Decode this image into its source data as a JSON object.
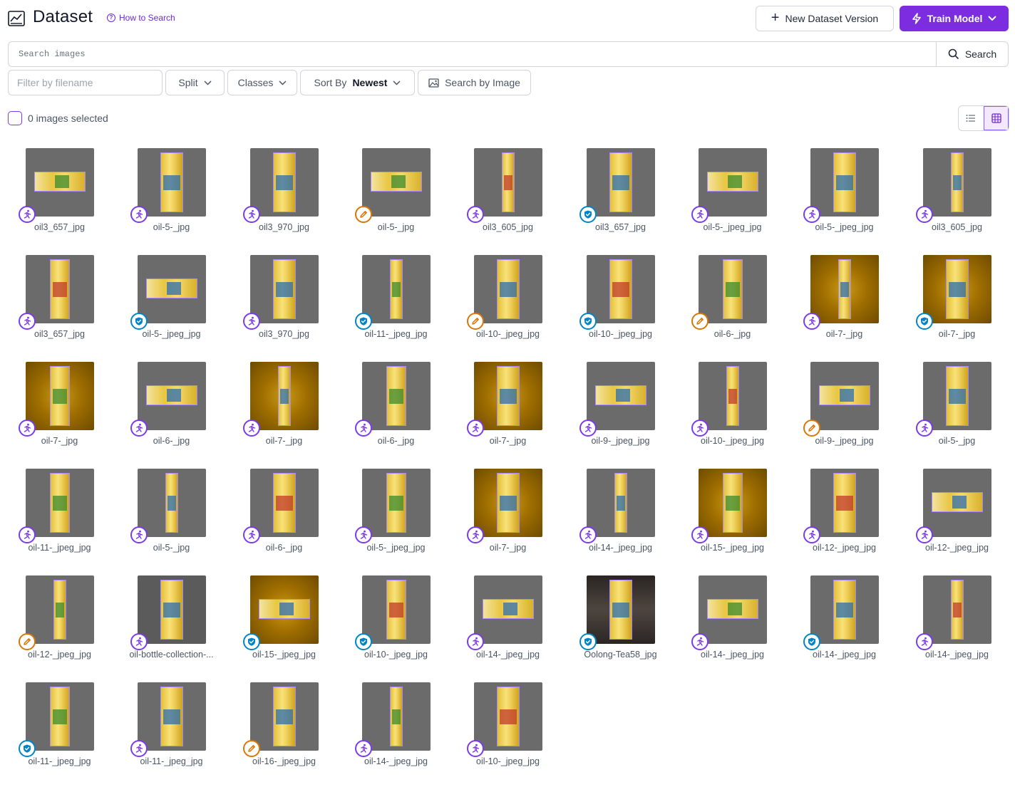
{
  "header": {
    "title": "Dataset",
    "how_to_search": "How to Search",
    "new_version_label": "New Dataset Version",
    "train_label": "Train Model"
  },
  "search": {
    "placeholder": "Search images",
    "button_label": "Search"
  },
  "filters": {
    "filename_placeholder": "Filter by filename",
    "split_label": "Split",
    "classes_label": "Classes",
    "sort_prefix": "Sort By",
    "sort_value": "Newest",
    "search_by_image_label": "Search by Image"
  },
  "selection": {
    "label": "0 images selected"
  },
  "colors": {
    "accent": "#7c2ddf",
    "badge_annotate": "#7c3aed",
    "badge_edit": "#d97706",
    "badge_approved": "#0284c7"
  },
  "images": [
    {
      "name": "oil3_657_jpg",
      "badge": "run",
      "bg": "gray",
      "orient": "h"
    },
    {
      "name": "oil-5-_jpg",
      "badge": "run",
      "bg": "gray",
      "orient": "v"
    },
    {
      "name": "oil3_970_jpg",
      "badge": "run",
      "bg": "gray",
      "orient": "v"
    },
    {
      "name": "oil-5-_jpg",
      "badge": "edit",
      "bg": "gray",
      "orient": "h"
    },
    {
      "name": "oil3_605_jpg",
      "badge": "run",
      "bg": "gray",
      "orient": "v"
    },
    {
      "name": "oil3_657_jpg",
      "badge": "shield",
      "bg": "gray",
      "orient": "v"
    },
    {
      "name": "oil-5-_jpeg_jpg",
      "badge": "run",
      "bg": "gray",
      "orient": "h"
    },
    {
      "name": "oil-5-_jpeg_jpg",
      "badge": "run",
      "bg": "gray",
      "orient": "v"
    },
    {
      "name": "oil3_605_jpg",
      "badge": "run",
      "bg": "gray",
      "orient": "v"
    },
    {
      "name": "oil3_657_jpg",
      "badge": "run",
      "bg": "gray",
      "orient": "v"
    },
    {
      "name": "oil-5-_jpeg_jpg",
      "badge": "shield",
      "bg": "gray",
      "orient": "h"
    },
    {
      "name": "oil3_970_jpg",
      "badge": "run",
      "bg": "gray",
      "orient": "v"
    },
    {
      "name": "oil-11-_jpeg_jpg",
      "badge": "shield",
      "bg": "gray",
      "orient": "v"
    },
    {
      "name": "oil-10-_jpeg_jpg",
      "badge": "edit",
      "bg": "gray",
      "orient": "v"
    },
    {
      "name": "oil-10-_jpeg_jpg",
      "badge": "shield",
      "bg": "gray",
      "orient": "v"
    },
    {
      "name": "oil-6-_jpg",
      "badge": "edit",
      "bg": "gray",
      "orient": "v"
    },
    {
      "name": "oil-7-_jpg",
      "badge": "run",
      "bg": "amber",
      "orient": "v"
    },
    {
      "name": "oil-7-_jpg",
      "badge": "shield",
      "bg": "amber",
      "orient": "v"
    },
    {
      "name": "oil-7-_jpg",
      "badge": "run",
      "bg": "amber",
      "orient": "v"
    },
    {
      "name": "oil-6-_jpg",
      "badge": "run",
      "bg": "gray",
      "orient": "h"
    },
    {
      "name": "oil-7-_jpg",
      "badge": "run",
      "bg": "amber",
      "orient": "v"
    },
    {
      "name": "oil-6-_jpg",
      "badge": "run",
      "bg": "gray",
      "orient": "v"
    },
    {
      "name": "oil-7-_jpg",
      "badge": "run",
      "bg": "amber",
      "orient": "v"
    },
    {
      "name": "oil-9-_jpeg_jpg",
      "badge": "run",
      "bg": "gray",
      "orient": "h"
    },
    {
      "name": "oil-10-_jpeg_jpg",
      "badge": "run",
      "bg": "gray",
      "orient": "v"
    },
    {
      "name": "oil-9-_jpeg_jpg",
      "badge": "edit",
      "bg": "gray",
      "orient": "h"
    },
    {
      "name": "oil-5-_jpg",
      "badge": "run",
      "bg": "gray",
      "orient": "v"
    },
    {
      "name": "oil-11-_jpeg_jpg",
      "badge": "run",
      "bg": "gray",
      "orient": "v"
    },
    {
      "name": "oil-5-_jpg",
      "badge": "run",
      "bg": "gray",
      "orient": "v"
    },
    {
      "name": "oil-6-_jpg",
      "badge": "run",
      "bg": "gray",
      "orient": "v"
    },
    {
      "name": "oil-5-_jpeg_jpg",
      "badge": "run",
      "bg": "gray",
      "orient": "v"
    },
    {
      "name": "oil-7-_jpg",
      "badge": "run",
      "bg": "amber",
      "orient": "v"
    },
    {
      "name": "oil-14-_jpeg_jpg",
      "badge": "run",
      "bg": "gray",
      "orient": "v"
    },
    {
      "name": "oil-15-_jpeg_jpg",
      "badge": "run",
      "bg": "amber",
      "orient": "v"
    },
    {
      "name": "oil-12-_jpeg_jpg",
      "badge": "run",
      "bg": "gray",
      "orient": "v"
    },
    {
      "name": "oil-12-_jpeg_jpg",
      "badge": "run",
      "bg": "gray",
      "orient": "h"
    },
    {
      "name": "oil-12-_jpeg_jpg",
      "badge": "edit",
      "bg": "gray",
      "orient": "v"
    },
    {
      "name": "oil-bottle-collection-...",
      "badge": "run",
      "bg": "collage",
      "orient": "v"
    },
    {
      "name": "oil-15-_jpeg_jpg",
      "badge": "shield",
      "bg": "amber",
      "orient": "h"
    },
    {
      "name": "oil-10-_jpeg_jpg",
      "badge": "shield",
      "bg": "gray",
      "orient": "v"
    },
    {
      "name": "oil-14-_jpeg_jpg",
      "badge": "run",
      "bg": "gray",
      "orient": "h"
    },
    {
      "name": "Oolong-Tea58_jpg",
      "badge": "shield",
      "bg": "dark",
      "orient": "v"
    },
    {
      "name": "oil-14-_jpeg_jpg",
      "badge": "run",
      "bg": "gray",
      "orient": "h"
    },
    {
      "name": "oil-14-_jpeg_jpg",
      "badge": "shield",
      "bg": "gray",
      "orient": "v"
    },
    {
      "name": "oil-14-_jpeg_jpg",
      "badge": "run",
      "bg": "gray",
      "orient": "v"
    },
    {
      "name": "oil-11-_jpeg_jpg",
      "badge": "shield",
      "bg": "gray",
      "orient": "v"
    },
    {
      "name": "oil-11-_jpeg_jpg",
      "badge": "run",
      "bg": "gray",
      "orient": "v"
    },
    {
      "name": "oil-16-_jpeg_jpg",
      "badge": "edit",
      "bg": "gray",
      "orient": "v"
    },
    {
      "name": "oil-14-_jpeg_jpg",
      "badge": "run",
      "bg": "gray",
      "orient": "v"
    },
    {
      "name": "oil-10-_jpeg_jpg",
      "badge": "run",
      "bg": "gray",
      "orient": "v"
    }
  ]
}
